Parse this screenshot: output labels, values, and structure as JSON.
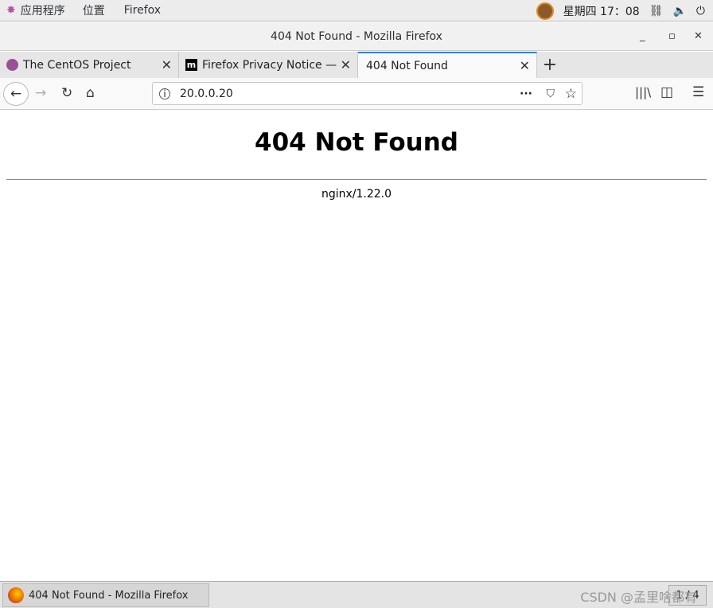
{
  "topbar": {
    "apps": "应用程序",
    "places": "位置",
    "app": "Firefox",
    "clock": "星期四 17：08"
  },
  "window": {
    "title": "404 Not Found - Mozilla Firefox"
  },
  "tabs": [
    {
      "label": "The CentOS Project"
    },
    {
      "label": "Firefox Privacy Notice — Mozilla"
    },
    {
      "label": "404 Not Found",
      "active": true
    }
  ],
  "nav": {
    "url": "20.0.0.20"
  },
  "page": {
    "heading": "404 Not Found",
    "server": "nginx/1.22.0"
  },
  "taskbar": {
    "task": "404 Not Found - Mozilla Firefox",
    "workspace": "1 / 4",
    "watermark": "CSDN @孟里啥都有"
  },
  "colors": {
    "accent": "#0a84ff"
  }
}
